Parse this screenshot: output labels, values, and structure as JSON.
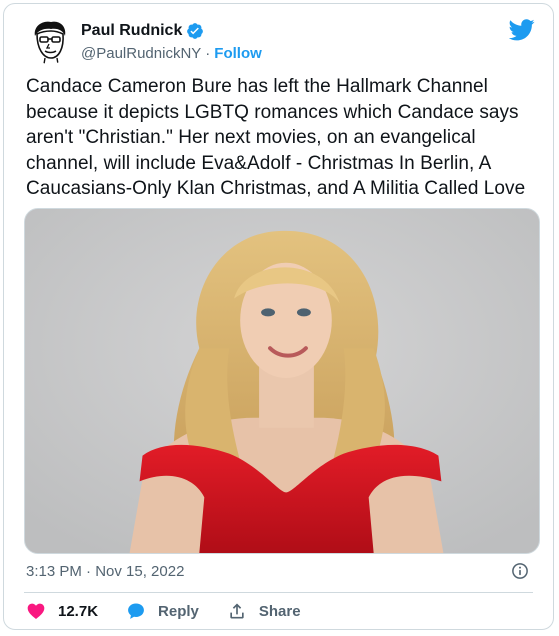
{
  "author": {
    "name": "Paul Rudnick",
    "handle": "@PaulRudnickNY",
    "separator": "·",
    "follow_label": "Follow"
  },
  "tweet": {
    "text": "Candace Cameron Bure has left the Hallmark Channel because it depicts LGBTQ romances which Candace says aren't \"Christian.\" Her next movies, on an evangelical channel, will include Eva&Adolf - Christmas In Berlin, A Caucasians-Only Klan Christmas, and A Militia Called Love",
    "timestamp": "3:13 PM · Nov 15, 2022"
  },
  "actions": {
    "likes_count": "12.7K",
    "reply_label": "Reply",
    "share_label": "Share"
  },
  "icons": {
    "verified": "verified-badge-icon",
    "bird": "twitter-bird-icon",
    "info": "info-icon",
    "like": "heart-icon",
    "reply": "speech-bubble-icon",
    "share": "share-upload-icon"
  },
  "colors": {
    "accent": "#1d9bf0",
    "like": "#f91880",
    "text": "#0f1419",
    "muted": "#536471",
    "border": "#cfd9de",
    "dress": "#d8121f",
    "photo_background": "#c9cacb"
  }
}
